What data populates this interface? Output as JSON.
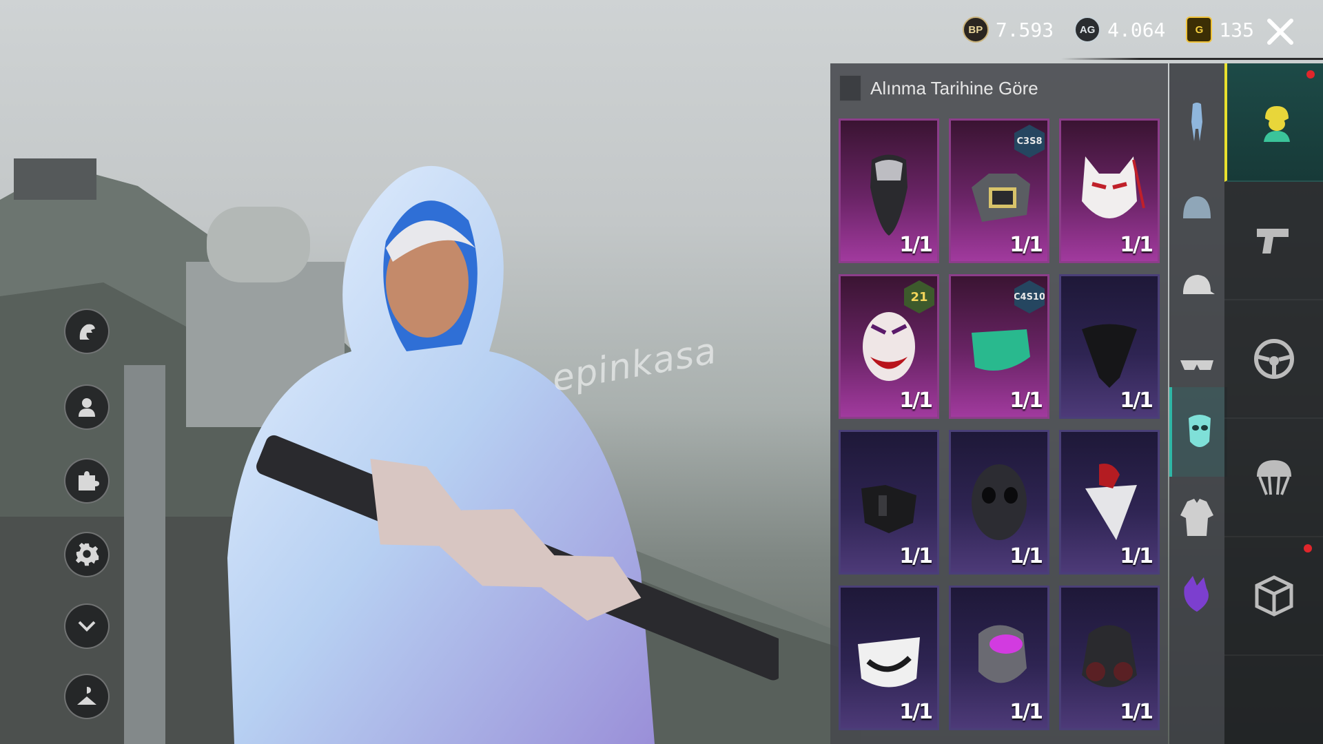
{
  "topbar": {
    "bp_icon": "BP",
    "bp_amount": "7.593",
    "ag_icon": "AG",
    "ag_amount": "4.064",
    "uc_icon": "G",
    "uc_amount": "135",
    "close_icon": "close-icon"
  },
  "watermark": "epinkasa",
  "left_menu": [
    {
      "name": "avatar-eagle-icon"
    },
    {
      "name": "profile-icon"
    },
    {
      "name": "puzzle-icon"
    },
    {
      "name": "settings-gear-icon"
    },
    {
      "name": "chevron-down-icon"
    },
    {
      "name": "wardrobe-hanger-icon"
    }
  ],
  "inventory": {
    "sort_label": "Alınma Tarihine Göre",
    "items": [
      {
        "icon": "skull-bandana-mask-icon",
        "rarity": "purple",
        "qty": "1/1",
        "badge": ""
      },
      {
        "icon": "respirator-mask-icon",
        "rarity": "purple",
        "qty": "1/1",
        "badge": "C3S8"
      },
      {
        "icon": "fox-kitsune-mask-icon",
        "rarity": "purple",
        "qty": "1/1",
        "badge": ""
      },
      {
        "icon": "joker-mask-icon",
        "rarity": "purple",
        "qty": "1/1",
        "badge": "21"
      },
      {
        "icon": "green-face-mask-icon",
        "rarity": "purple",
        "qty": "1/1",
        "badge": "C4S10"
      },
      {
        "icon": "black-bandana-icon",
        "rarity": "blue",
        "qty": "1/1",
        "badge": ""
      },
      {
        "icon": "tactical-mouth-guard-icon",
        "rarity": "blue",
        "qty": "1/1",
        "badge": ""
      },
      {
        "icon": "dark-skull-mask-icon",
        "rarity": "blue",
        "qty": "1/1",
        "badge": ""
      },
      {
        "icon": "white-red-bandana-icon",
        "rarity": "blue",
        "qty": "1/1",
        "badge": ""
      },
      {
        "icon": "smile-face-mask-icon",
        "rarity": "blue",
        "qty": "1/1",
        "badge": ""
      },
      {
        "icon": "pink-cyber-mask-icon",
        "rarity": "blue",
        "qty": "1/1",
        "badge": ""
      },
      {
        "icon": "gas-mask-icon",
        "rarity": "blue",
        "qty": "1/1",
        "badge": ""
      }
    ]
  },
  "categories": [
    {
      "name": "outfit-icon",
      "active": false
    },
    {
      "name": "helmet-icon",
      "active": false
    },
    {
      "name": "cap-icon",
      "active": false
    },
    {
      "name": "glasses-icon",
      "active": false
    },
    {
      "name": "face-mask-icon",
      "active": true
    },
    {
      "name": "jacket-icon",
      "active": false
    },
    {
      "name": "mascot-icon",
      "active": false
    }
  ],
  "main_tabs": [
    {
      "name": "character-tab-icon",
      "active": true,
      "dot": true
    },
    {
      "name": "pistol-tab-icon",
      "active": false,
      "dot": false
    },
    {
      "name": "steering-wheel-tab-icon",
      "active": false,
      "dot": false
    },
    {
      "name": "parachute-tab-icon",
      "active": false,
      "dot": false
    },
    {
      "name": "crate-tab-icon",
      "active": false,
      "dot": true
    }
  ],
  "colors": {
    "rarity_purple": "#8c3d8a",
    "rarity_blue": "#4a3f78",
    "active_tab": "#1d4a47",
    "accent_yellow": "#e9e02e",
    "alert_red": "#e0262b"
  }
}
